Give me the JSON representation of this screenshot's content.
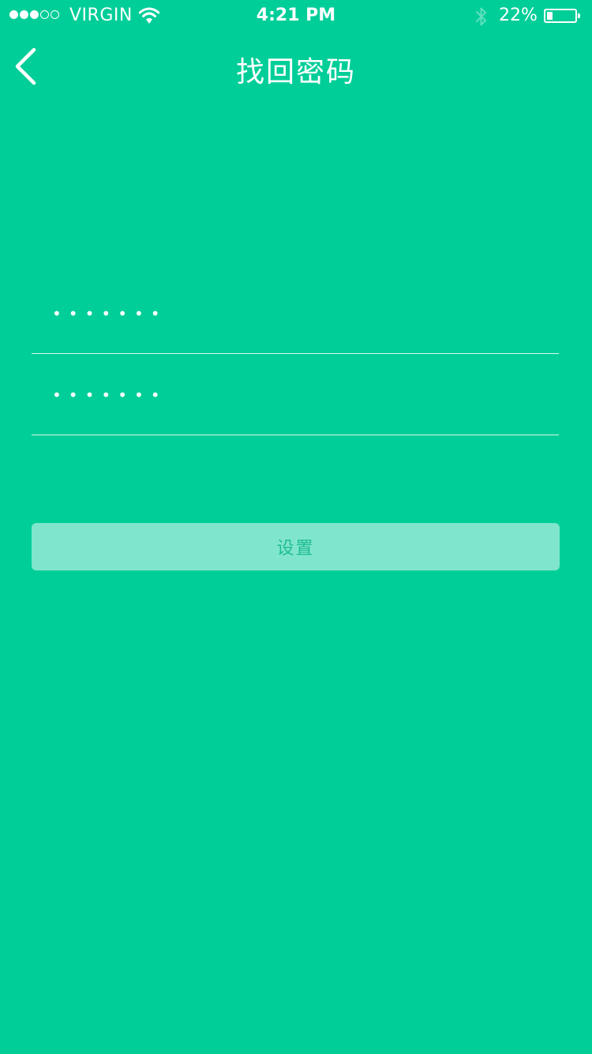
{
  "status_bar": {
    "signal_bars_filled": 3,
    "signal_bars_total": 5,
    "carrier": "VIRGIN",
    "time": "4:21 PM",
    "battery_percent": "22%",
    "battery_level": 0.22,
    "icons": [
      "wifi-icon",
      "bluetooth-icon",
      "battery-icon"
    ]
  },
  "nav": {
    "back_icon": "chevron-left-icon",
    "title": "找回密码"
  },
  "form": {
    "new_password_value": "•••••••",
    "confirm_password_value": "•••••••",
    "submit_label": "设置"
  },
  "colors": {
    "background": "#00CE98",
    "button_background": "#80E6CB",
    "button_text": "#1EBC91",
    "text": "#FFFFFF"
  }
}
